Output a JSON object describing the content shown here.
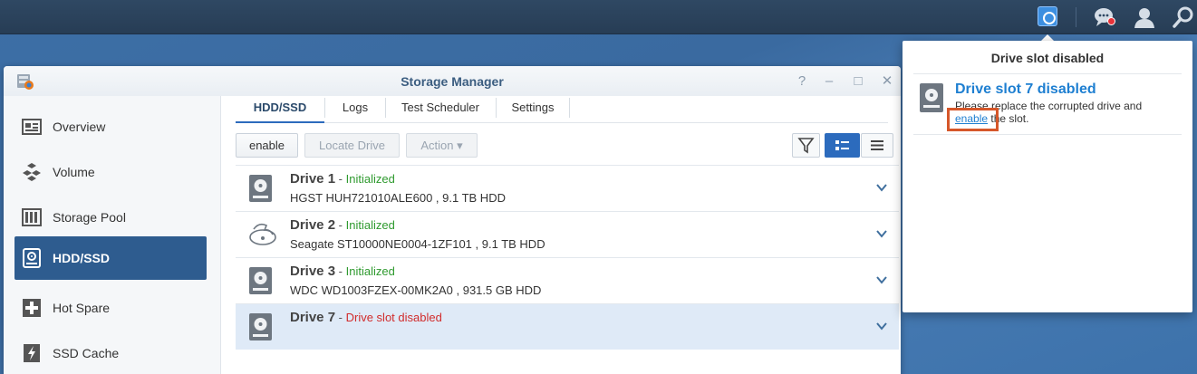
{
  "taskbar": {
    "icons": [
      "storage-notification-icon",
      "chat-icon",
      "user-icon",
      "search-icon"
    ]
  },
  "window": {
    "title": "Storage Manager",
    "controls": [
      "?",
      "–",
      "□",
      "✕"
    ]
  },
  "sidebar": {
    "items": [
      {
        "label": "Overview",
        "icon": "overview-icon"
      },
      {
        "label": "Volume",
        "icon": "volume-icon"
      },
      {
        "label": "Storage Pool",
        "icon": "storage-pool-icon"
      },
      {
        "label": "HDD/SSD",
        "icon": "hdd-icon",
        "active": true
      },
      {
        "label": "Hot Spare",
        "icon": "hot-spare-icon"
      },
      {
        "label": "SSD Cache",
        "icon": "ssd-cache-icon"
      }
    ]
  },
  "tabs": [
    {
      "label": "HDD/SSD",
      "active": true
    },
    {
      "label": "Logs"
    },
    {
      "label": "Test Scheduler"
    },
    {
      "label": "Settings"
    }
  ],
  "toolbar": {
    "enable_label": "enable",
    "locate_label": "Locate Drive",
    "action_label": "Action ▾"
  },
  "drives": [
    {
      "name": "Drive 1",
      "sep": " - ",
      "status": "Initialized",
      "model": "HGST HUH721010ALE600 , 9.1 TB HDD"
    },
    {
      "name": "Drive 2",
      "sep": " - ",
      "status": "Initialized",
      "model": "Seagate ST10000NE0004-1ZF101 , 9.1 TB HDD"
    },
    {
      "name": "Drive 3",
      "sep": " - ",
      "status": "Initialized",
      "model": "WDC WD1003FZEX-00MK2A0 , 931.5 GB HDD"
    },
    {
      "name": "Drive 7",
      "sep": " - ",
      "status": "Drive slot disabled",
      "model": ""
    }
  ],
  "popup": {
    "header": "Drive slot disabled",
    "title": "Drive slot 7 disabled",
    "text_line1": "Please replace the corrupted drive and",
    "link": "enable",
    "text_line2_rest": " the slot."
  },
  "colors": {
    "accent": "#2c6bbd",
    "ok": "#2f9a2f",
    "error": "#d12c2c",
    "link": "#1e7fd1",
    "highlight": "#d6572a"
  }
}
